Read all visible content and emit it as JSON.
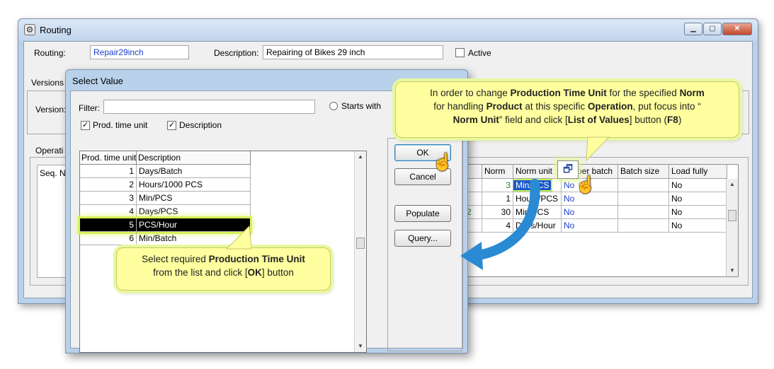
{
  "main_window": {
    "title": "Routing",
    "routing_label": "Routing:",
    "routing_value": "Repair29inch",
    "description_label": "Description:",
    "description_value": "Repairing of Bikes 29 inch",
    "active_label": "Active",
    "versions_label": "Versions",
    "version_label": "Version:",
    "operations_label": "Operati",
    "seq_label": "Seq. N",
    "grid": {
      "headers": [
        "Norm",
        "Norm unit",
        "per batch",
        "Batch size",
        "Load fully"
      ],
      "rows": [
        {
          "left": "",
          "norm": "3",
          "unit": "Min/PCS",
          "per_batch": "No",
          "batch_size": "",
          "load": "No"
        },
        {
          "left": "",
          "norm": "1",
          "unit": "Hours/PCS",
          "per_batch": "No",
          "batch_size": "",
          "load": "No"
        },
        {
          "left": "2",
          "norm": "30",
          "unit": "Min/PCS",
          "per_batch": "No",
          "batch_size": "",
          "load": "No"
        },
        {
          "left": "",
          "norm": "4",
          "unit": "Days/Hour",
          "per_batch": "No",
          "batch_size": "",
          "load": "No"
        }
      ]
    }
  },
  "dialog": {
    "title": "Select Value",
    "filter_label": "Filter:",
    "filter_value": "",
    "starts_with_label": "Starts with",
    "check_prod_label": "Prod. time unit",
    "check_desc_label": "Description",
    "list_headers": [
      "Prod. time unit",
      "Description"
    ],
    "list_rows": [
      {
        "id": "1",
        "desc": "Days/Batch"
      },
      {
        "id": "2",
        "desc": "Hours/1000 PCS"
      },
      {
        "id": "3",
        "desc": "Min/PCS"
      },
      {
        "id": "4",
        "desc": "Days/PCS"
      },
      {
        "id": "5",
        "desc": "PCS/Hour"
      },
      {
        "id": "6",
        "desc": "Min/Batch"
      }
    ],
    "selected_index": 4,
    "ok_label": "OK",
    "cancel_label": "Cancel",
    "populate_label": "Populate",
    "query_label": "Query..."
  },
  "callout_top": {
    "p1": "In order to change ",
    "b1": "Production Time Unit",
    "p2": " for the specified ",
    "b2": "Norm",
    "p3": " for handling ",
    "b3": "Product",
    "p4": " at this specific ",
    "b4": "Operation",
    "p5": ", put focus into “",
    "b5": "Norm Unit",
    "p6": "” field and click [",
    "b6": "List of Values",
    "p7": "] button (",
    "b7": "F8",
    "p8": ")"
  },
  "callout_bottom": {
    "p1": "Select required ",
    "b1": "Production Time Unit",
    "p2": " from the list and click [",
    "b2": "OK",
    "p3": "] button"
  },
  "colors": {
    "highlight": "#d5f25a",
    "callout_bg": "#ffff9f",
    "arrow": "#2a8ad4",
    "link_blue": "#1a3fd1"
  }
}
